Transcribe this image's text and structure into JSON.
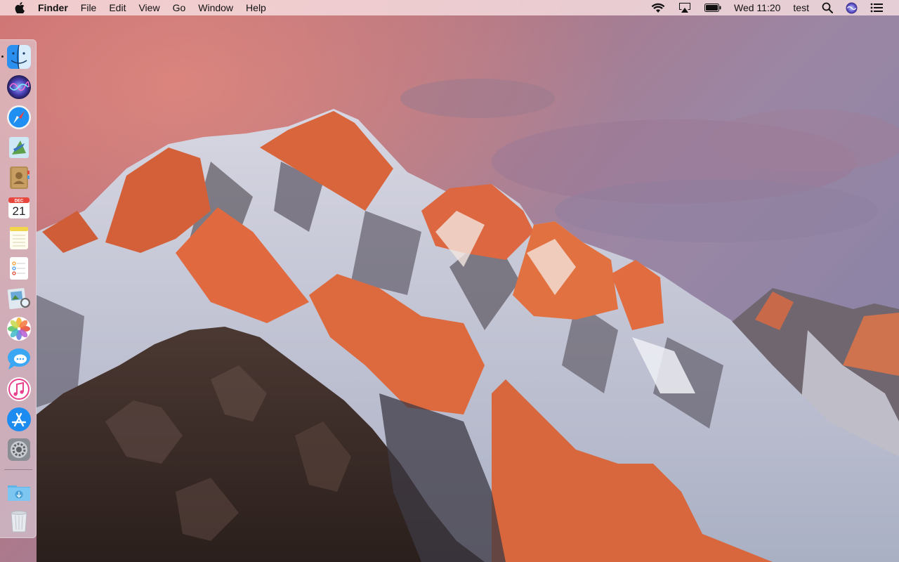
{
  "menubar": {
    "apple_icon": "apple-icon",
    "app_name": "Finder",
    "menus": [
      "File",
      "Edit",
      "View",
      "Go",
      "Window",
      "Help"
    ],
    "status": {
      "wifi_icon": "wifi-icon",
      "airplay_icon": "airplay-icon",
      "battery_icon": "battery-icon",
      "clock": "Wed 11:20",
      "user": "test",
      "spotlight_icon": "spotlight-search-icon",
      "siri_icon": "siri-icon",
      "notification_center_icon": "notification-center-icon"
    }
  },
  "dock": {
    "apps": [
      {
        "name": "finder-icon",
        "running": true
      },
      {
        "name": "siri-icon"
      },
      {
        "name": "safari-icon"
      },
      {
        "name": "mail-icon"
      },
      {
        "name": "contacts-icon"
      },
      {
        "name": "calendar-icon",
        "month": "DEC",
        "day": "21"
      },
      {
        "name": "notes-icon"
      },
      {
        "name": "reminders-icon"
      },
      {
        "name": "preview-icon"
      },
      {
        "name": "photos-icon"
      },
      {
        "name": "messages-icon"
      },
      {
        "name": "itunes-icon"
      },
      {
        "name": "app-store-icon"
      },
      {
        "name": "system-preferences-icon"
      },
      {
        "name": "downloads-folder-icon"
      },
      {
        "name": "trash-icon"
      }
    ]
  },
  "colors": {
    "menubar_bg": "#f6dee1",
    "sky_top": "#c36a72",
    "sky_right": "#8d7c9c",
    "mountain_lit": "#e0683c",
    "snow": "#e9eaf1",
    "rock_dark": "#3e2f2b"
  }
}
